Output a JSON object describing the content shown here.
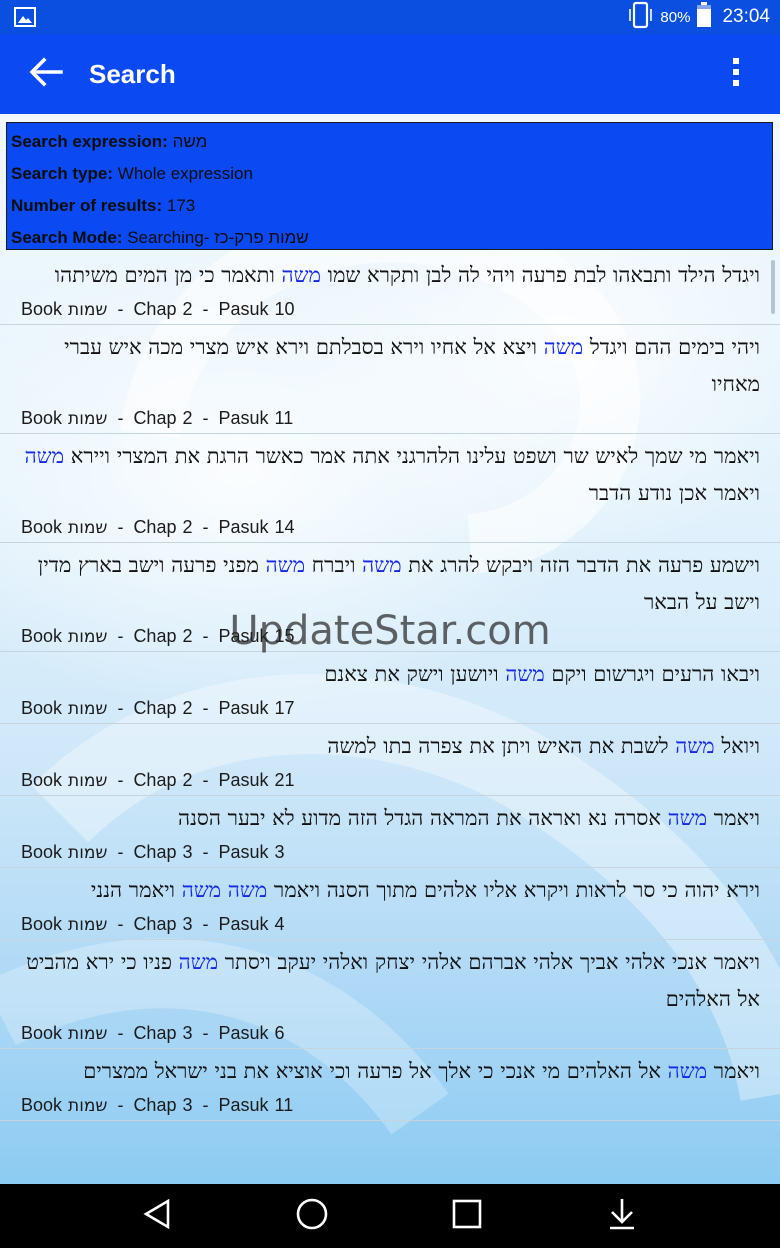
{
  "status_bar": {
    "battery_percent": "80%",
    "time": "23:04"
  },
  "app_bar": {
    "title": "Search"
  },
  "search_info": {
    "expression_label": "Search expression:",
    "expression_value": "משה",
    "type_label": "Search type:",
    "type_value": "Whole expression",
    "count_label": "Number of results:",
    "count_value": "173",
    "mode_label": "Search Mode:",
    "mode_value": "Searching- שמות פרק-כז"
  },
  "watermark": "UpdateStar.com",
  "results": [
    {
      "segments": [
        {
          "t": "ויגדל הילד ותבאהו לבת פרעה ויהי לה לבן ותקרא שמו "
        },
        {
          "t": "משה",
          "hl": true
        },
        {
          "t": " ותאמר כי מן המים משיתהו"
        }
      ],
      "book_label": "Book",
      "book": "שמות",
      "chap_label": "Chap",
      "chap": "2",
      "pasuk_label": "Pasuk",
      "pasuk": "10"
    },
    {
      "segments": [
        {
          "t": "ויהי  בימים ההם ויגדל "
        },
        {
          "t": "משה",
          "hl": true
        },
        {
          "t": " ויצא אל אחיו וירא בסבלתם וירא איש מצרי מכה איש עברי מאחיו"
        }
      ],
      "book_label": "Book",
      "book": "שמות",
      "chap_label": "Chap",
      "chap": "2",
      "pasuk_label": "Pasuk",
      "pasuk": "11"
    },
    {
      "segments": [
        {
          "t": "ויאמר מי שמך לאיש שר ושפט עלינו הלהרגני אתה אמר כאשר הרגת את המצרי ויירא "
        },
        {
          "t": "משה",
          "hl": true
        },
        {
          "t": " ויאמר אכן נודע הדבר"
        }
      ],
      "book_label": "Book",
      "book": "שמות",
      "chap_label": "Chap",
      "chap": "2",
      "pasuk_label": "Pasuk",
      "pasuk": "14"
    },
    {
      "segments": [
        {
          "t": "וישמע פרעה את הדבר הזה ויבקש להרג את "
        },
        {
          "t": "משה",
          "hl": true
        },
        {
          "t": " ויברח "
        },
        {
          "t": "משה",
          "hl": true
        },
        {
          "t": " מפני פרעה וישב בארץ מדין וישב על הבאר"
        }
      ],
      "book_label": "Book",
      "book": "שמות",
      "chap_label": "Chap",
      "chap": "2",
      "pasuk_label": "Pasuk",
      "pasuk": "15"
    },
    {
      "segments": [
        {
          "t": "ויבאו הרעים ויגרשום ויקם "
        },
        {
          "t": "משה",
          "hl": true
        },
        {
          "t": " ויושען וישק את צאנם"
        }
      ],
      "book_label": "Book",
      "book": "שמות",
      "chap_label": "Chap",
      "chap": "2",
      "pasuk_label": "Pasuk",
      "pasuk": "17"
    },
    {
      "segments": [
        {
          "t": "ויואל "
        },
        {
          "t": "משה",
          "hl": true
        },
        {
          "t": " לשבת את האיש ויתן את צפרה בתו למשה"
        }
      ],
      "book_label": "Book",
      "book": "שמות",
      "chap_label": "Chap",
      "chap": "2",
      "pasuk_label": "Pasuk",
      "pasuk": "21"
    },
    {
      "segments": [
        {
          "t": "ויאמר "
        },
        {
          "t": "משה",
          "hl": true
        },
        {
          "t": " אסרה נא ואראה את המראה הגדל הזה מדוע לא יבער הסנה"
        }
      ],
      "book_label": "Book",
      "book": "שמות",
      "chap_label": "Chap",
      "chap": "3",
      "pasuk_label": "Pasuk",
      "pasuk": "3"
    },
    {
      "segments": [
        {
          "t": "וירא יהוה כי סר לראות ויקרא אליו אלהים מתוך הסנה ויאמר "
        },
        {
          "t": "משה משה",
          "hl": true
        },
        {
          "t": " ויאמר הנני"
        }
      ],
      "book_label": "Book",
      "book": "שמות",
      "chap_label": "Chap",
      "chap": "3",
      "pasuk_label": "Pasuk",
      "pasuk": "4"
    },
    {
      "segments": [
        {
          "t": "ויאמר אנכי אלהי אביך אלהי אברהם אלהי יצחק ואלהי יעקב ויסתר "
        },
        {
          "t": "משה",
          "hl": true
        },
        {
          "t": " פניו כי ירא מהביט אל האלהים"
        }
      ],
      "book_label": "Book",
      "book": "שמות",
      "chap_label": "Chap",
      "chap": "3",
      "pasuk_label": "Pasuk",
      "pasuk": "6"
    },
    {
      "segments": [
        {
          "t": "ויאמר "
        },
        {
          "t": "משה",
          "hl": true
        },
        {
          "t": " אל האלהים מי אנכי כי אלך אל פרעה וכי אוציא את בני ישראל ממצרים"
        }
      ],
      "book_label": "Book",
      "book": "שמות",
      "chap_label": "Chap",
      "chap": "3",
      "pasuk_label": "Pasuk",
      "pasuk": "11"
    }
  ],
  "icons": {
    "status_left": "image-icon",
    "battery": "battery-icon",
    "phone": "phone-rotate-icon",
    "back": "arrow-back-icon",
    "overflow": "more-vert-icon",
    "nav_back": "triangle-back-icon",
    "nav_home": "circle-home-icon",
    "nav_recents": "square-recents-icon",
    "nav_download": "download-icon"
  },
  "colors": {
    "primary": "#0b49f2",
    "status_bar": "#0a4fe0",
    "highlight": "#1227e8"
  }
}
